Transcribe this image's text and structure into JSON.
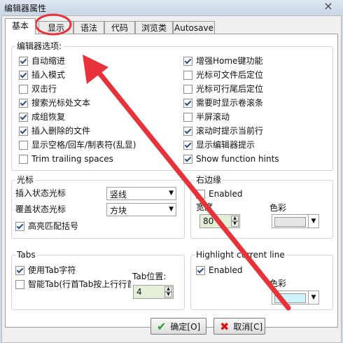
{
  "window": {
    "title": "编辑器属性",
    "close": "×"
  },
  "tabs": [
    "基本",
    "显示",
    "语法",
    "代码",
    "浏览类",
    "Autosave"
  ],
  "editor_options": {
    "title": "编辑器选项:",
    "left": [
      {
        "label": "自动缩进",
        "checked": true
      },
      {
        "label": "插入模式",
        "checked": true
      },
      {
        "label": "双击行",
        "checked": false
      },
      {
        "label": "搜索光标处文本",
        "checked": true
      },
      {
        "label": "成组恢复",
        "checked": true
      },
      {
        "label": "插入删除的文件",
        "checked": true
      },
      {
        "label": "显示空格/回车/制表符(乱显)",
        "checked": false
      },
      {
        "label": "Trim trailing spaces",
        "checked": false
      }
    ],
    "right": [
      {
        "label": "增强Home键功能",
        "checked": true
      },
      {
        "label": "光标可文件后定位",
        "checked": false
      },
      {
        "label": "光标可行尾后定位",
        "checked": false
      },
      {
        "label": "需要时显示卷滚条",
        "checked": true
      },
      {
        "label": "半屏滚动",
        "checked": false
      },
      {
        "label": "滚动时提示当前行",
        "checked": true
      },
      {
        "label": "显示编辑器提示",
        "checked": true
      },
      {
        "label": "Show function hints",
        "checked": true
      }
    ]
  },
  "cursor": {
    "title": "光标",
    "insert_label": "插入状态光标",
    "insert_value": "竖线",
    "overwrite_label": "覆盖状态光标",
    "overwrite_value": "方块",
    "highlight_brackets": {
      "label": "高亮匹配括号",
      "checked": true
    }
  },
  "right_margin": {
    "title": "右边缘",
    "enabled": {
      "label": "Enabled",
      "checked": false
    },
    "width_label": "宽度",
    "width_value": "80",
    "color_label": "色彩",
    "color": "#e6e6e6"
  },
  "tabs_group": {
    "title": "Tabs",
    "use_tab": {
      "label": "使用Tab字符",
      "checked": true
    },
    "smart_tab": {
      "label": "智能Tab(行首Tab按上行行首",
      "checked": false
    },
    "tab_pos_label": "Tab位置:",
    "tab_pos_value": "4"
  },
  "highlight_line": {
    "title": "Highlight current line",
    "enabled": {
      "label": "Enabled",
      "checked": true
    },
    "color_label": "色彩",
    "color": "#cdf3fb"
  },
  "buttons": {
    "ok": "确定[O]",
    "cancel": "取消[C]"
  },
  "annotation_color": "#e8323a"
}
